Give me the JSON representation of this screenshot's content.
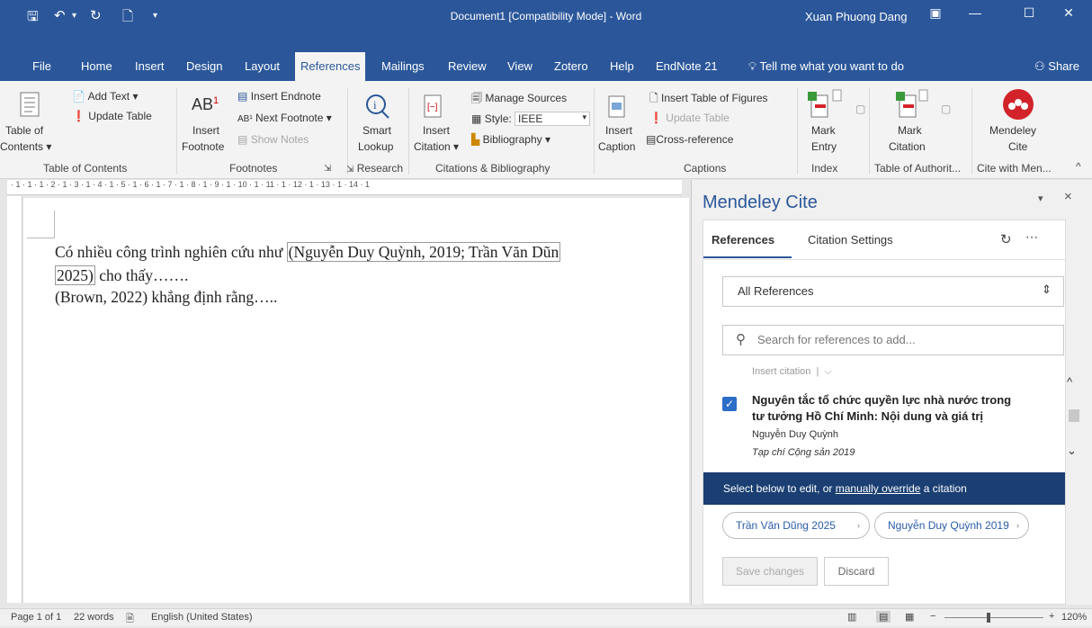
{
  "titlebar": {
    "doc_title": "Document1 [Compatibility Mode]  -  Word",
    "user": "Xuan Phuong Dang",
    "icons": [
      "save-icon",
      "undo-icon",
      "redo-icon",
      "new-doc-icon",
      "customize-icon"
    ]
  },
  "tabs": [
    "File",
    "Home",
    "Insert",
    "Design",
    "Layout",
    "References",
    "Mailings",
    "Review",
    "View",
    "Zotero",
    "Help",
    "EndNote 21"
  ],
  "active_tab": "References",
  "tell_me": "Tell me what you want to do",
  "share": "Share",
  "ribbon": {
    "toc": {
      "label1": "Table of",
      "label2": "Contents",
      "add_text": "Add Text",
      "update_table": "Update Table",
      "group": "Table of Contents"
    },
    "footnotes": {
      "insert1": "Insert",
      "insert2": "Footnote",
      "insert_endnote": "Insert Endnote",
      "next_footnote": "Next Footnote",
      "show_notes": "Show Notes",
      "group": "Footnotes"
    },
    "research": {
      "smart1": "Smart",
      "smart2": "Lookup",
      "group": "Research"
    },
    "citations": {
      "insert1": "Insert",
      "insert2": "Citation",
      "manage_sources": "Manage Sources",
      "style_label": "Style:",
      "style_value": "IEEE",
      "bibliography": "Bibliography",
      "group": "Citations & Bibliography"
    },
    "captions": {
      "insert1": "Insert",
      "insert2": "Caption",
      "insert_tof": "Insert Table of Figures",
      "update_table": "Update Table",
      "cross_ref": "Cross-reference",
      "group": "Captions"
    },
    "index": {
      "mark1": "Mark",
      "mark2": "Entry",
      "group": "Index"
    },
    "toa": {
      "mark1": "Mark",
      "mark2": "Citation",
      "group": "Table of Authorit..."
    },
    "mendeley": {
      "label1": "Mendeley",
      "label2": "Cite",
      "group": "Cite with Men..."
    }
  },
  "ruler": "· 1 · 1 · 1 · 2 · 1 · 3 · 1 · 4 · 1 · 5 · 1 · 6 · 1 · 7 · 1 · 8 · 1 · 9 · 1 · 10 · 1 · 11 · 1 · 12 · 1 · 13 · 1 · 14 · 1",
  "document": {
    "line1_pre": "Có nhiều công trình nghiên cứu như ",
    "line1_cite": "(Nguyễn Duy Quỳnh, 2019; Trần Văn Dũn",
    "line2_cite": "2025)",
    "line2_post": " cho thấy…….",
    "line3": "(Brown, 2022) khẳng định rằng….."
  },
  "pane": {
    "title": "Mendeley Cite",
    "tab_references": "References",
    "tab_settings": "Citation Settings",
    "filter": "All References",
    "search_placeholder": "Search for references to add...",
    "insert_citation": "Insert citation",
    "reference": {
      "title_line1": "Nguyên tắc tổ chức quyền lực nhà nước trong",
      "title_line2": "tư tưởng Hồ Chí Minh: Nội dung và giá trị",
      "author": "Nguyễn Duy Quỳnh",
      "source": "Tạp chí Cộng sản 2019",
      "checked": true
    },
    "banner_pre": "Select below to edit, or ",
    "banner_link": "manually override",
    "banner_post": " a citation",
    "chips": [
      "Trần Văn Dũng 2025",
      "Nguyễn Duy Quỳnh 2019"
    ],
    "save": "Save changes",
    "discard": "Discard"
  },
  "status": {
    "page": "Page 1 of 1",
    "words": "22 words",
    "language": "English (United States)",
    "zoom": "120%"
  },
  "colors": {
    "word_blue": "#2b579a",
    "banner": "#1b3f73",
    "mendeley_red": "#d2232a",
    "link": "#2a5ca8"
  }
}
